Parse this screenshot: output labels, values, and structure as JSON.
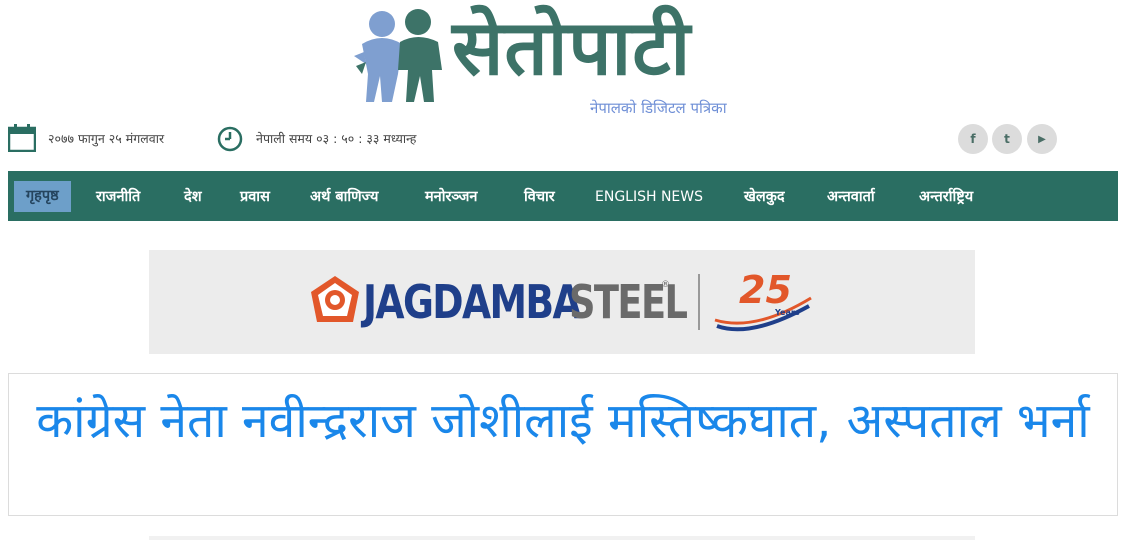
{
  "brand": {
    "title": "सेतोपाटी",
    "tagline": "नेपालको डिजिटल पत्रिका",
    "color": "#3d7368"
  },
  "topbar": {
    "date": "२०७७ फागुन २५ मंगलवार",
    "time": "नेपाली समय ०३ : ५० : ३३ मध्यान्ह",
    "icons": [
      "calendar-icon",
      "clock-icon"
    ],
    "social": [
      {
        "name": "facebook-icon",
        "glyph": "f"
      },
      {
        "name": "twitter-icon",
        "glyph": "t"
      },
      {
        "name": "youtube-icon",
        "glyph": "▶"
      }
    ]
  },
  "nav": {
    "color": "#2a6e62",
    "active_color": "#6d9fc9",
    "items": [
      {
        "label": "गृहपृष्ठ"
      },
      {
        "label": "राजनीति"
      },
      {
        "label": "देश"
      },
      {
        "label": "प्रवास"
      },
      {
        "label": "अर्थ बाणिज्य"
      },
      {
        "label": "मनोरञ्जन"
      },
      {
        "label": "विचार"
      },
      {
        "label": "ENGLISH NEWS"
      },
      {
        "label": "खेलकुद"
      },
      {
        "label": "अन्तवार्ता"
      },
      {
        "label": "अन्तर्राष्ट्रिय"
      }
    ]
  },
  "ad": {
    "brand_main": "JAGDAMBA",
    "brand_sub": "STEEL",
    "anniversary": "25",
    "anniversary_label": "Years"
  },
  "headline": {
    "text": "कांग्रेस नेता नवीन्द्रराज जोशीलाई मस्तिष्कघात, अस्पताल भर्ना",
    "color": "#1a87ea"
  }
}
